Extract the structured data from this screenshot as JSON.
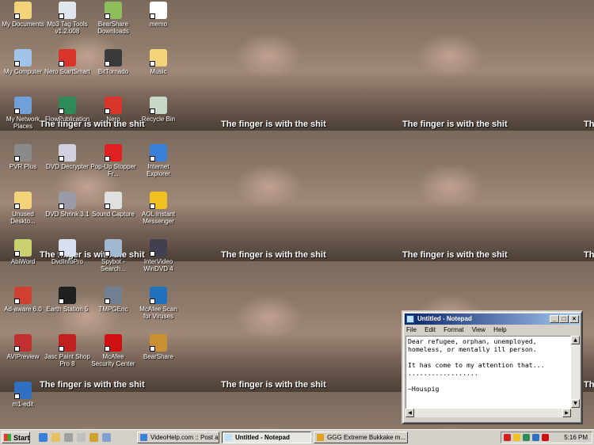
{
  "wallpaper": {
    "caption": "The finger is with the shit"
  },
  "desktop_icons": [
    {
      "label": "My Documents",
      "icon": "my-documents-icon",
      "color": "#f2d37a"
    },
    {
      "label": "Mp3 Tag Tools v1.2.008",
      "icon": "mp3-tag-tools-icon",
      "color": "#dfe6ee"
    },
    {
      "label": "BearShare Downloads",
      "icon": "bearshare-downloads-icon",
      "color": "#8fbf5a"
    },
    {
      "label": "memo",
      "icon": "text-file-icon",
      "color": "#ffffff"
    },
    {
      "label": "My Computer",
      "icon": "my-computer-icon",
      "color": "#9fc4e8"
    },
    {
      "label": "Nero StartSmart",
      "icon": "nero-startsmart-icon",
      "color": "#d9352a"
    },
    {
      "label": "BitTornado",
      "icon": "bittornado-icon",
      "color": "#3a3a3a"
    },
    {
      "label": "Music",
      "icon": "music-folder-icon",
      "color": "#f2d37a"
    },
    {
      "label": "My Network Places",
      "icon": "network-places-icon",
      "color": "#6fa0d8"
    },
    {
      "label": "FlowPublication",
      "icon": "flowpublication-icon",
      "color": "#2e8b57"
    },
    {
      "label": "Nero",
      "icon": "nero-icon",
      "color": "#d9352a"
    },
    {
      "label": "Recycle Bin",
      "icon": "recycle-bin-icon",
      "color": "#c8d8c8"
    },
    {
      "label": "PVR Plus",
      "icon": "pvr-plus-icon",
      "color": "#8a8a8a"
    },
    {
      "label": "DVD Decrypter",
      "icon": "dvd-decrypter-icon",
      "color": "#d0d0e0"
    },
    {
      "label": "Pop-Up Stopper Fr...",
      "icon": "popup-stopper-icon",
      "color": "#e02020"
    },
    {
      "label": "Internet Explorer",
      "icon": "internet-explorer-icon",
      "color": "#3a7fd8"
    },
    {
      "label": "Unused Deskto...",
      "icon": "folder-icon",
      "color": "#f2d37a"
    },
    {
      "label": "DVD Shrink 3.1",
      "icon": "dvd-shrink-icon",
      "color": "#9a9aa8"
    },
    {
      "label": "Sound Capture",
      "icon": "sound-capture-icon",
      "color": "#e0e0e0"
    },
    {
      "label": "AOL Instant Messenger",
      "icon": "aol-instant-messenger-icon",
      "color": "#f0c020"
    },
    {
      "label": "AbiWord",
      "icon": "abiword-icon",
      "color": "#c8d070"
    },
    {
      "label": "DvdInfoPro",
      "icon": "dvdinfopro-icon",
      "color": "#d8e0f0"
    },
    {
      "label": "Spybot - Search...",
      "icon": "spybot-icon",
      "color": "#a0b8d0"
    },
    {
      "label": "InterVideo WinDVD 4",
      "icon": "windvd-icon",
      "color": "#404050"
    },
    {
      "label": "Ad-aware 6.0",
      "icon": "ad-aware-icon",
      "color": "#d04030"
    },
    {
      "label": "Earth Station 5",
      "icon": "earth-station-icon",
      "color": "#202020"
    },
    {
      "label": "TMPGEnc",
      "icon": "tmpgenc-icon",
      "color": "#708090"
    },
    {
      "label": "McAfee Scan for Viruses",
      "icon": "mcafee-scan-icon",
      "color": "#2070c0"
    },
    {
      "label": "AVIPreview",
      "icon": "avipreview-icon",
      "color": "#c03030"
    },
    {
      "label": "Jasc Paint Shop Pro 8",
      "icon": "paint-shop-pro-icon",
      "color": "#c02020"
    },
    {
      "label": "McAfee Security Center",
      "icon": "mcafee-security-center-icon",
      "color": "#d01010"
    },
    {
      "label": "BearShare",
      "icon": "bearshare-icon",
      "color": "#c89030"
    },
    {
      "label": "m1-edit",
      "icon": "m1-edit-icon",
      "color": "#3070c0"
    }
  ],
  "notepad": {
    "title": "Untitled - Notepad",
    "menu": [
      "File",
      "Edit",
      "Format",
      "View",
      "Help"
    ],
    "lines": [
      "Dear refugee, orphan, unemployed,",
      "homeless, or mentally ill person.",
      "",
      "It has come to my attention that...",
      "..................",
      "",
      "~Houspig"
    ]
  },
  "taskbar": {
    "start_label": "Start",
    "tasks": [
      {
        "label": "VideoHelp.com :: Post a r...",
        "icon_color": "#3a7fd8",
        "active": false
      },
      {
        "label": "Untitled - Notepad",
        "icon_color": "#bfe0f5",
        "active": true
      },
      {
        "label": "GGG Extreme Bukkake m...",
        "icon_color": "#e0a020",
        "active": false
      }
    ],
    "clock": "5:16 PM"
  }
}
